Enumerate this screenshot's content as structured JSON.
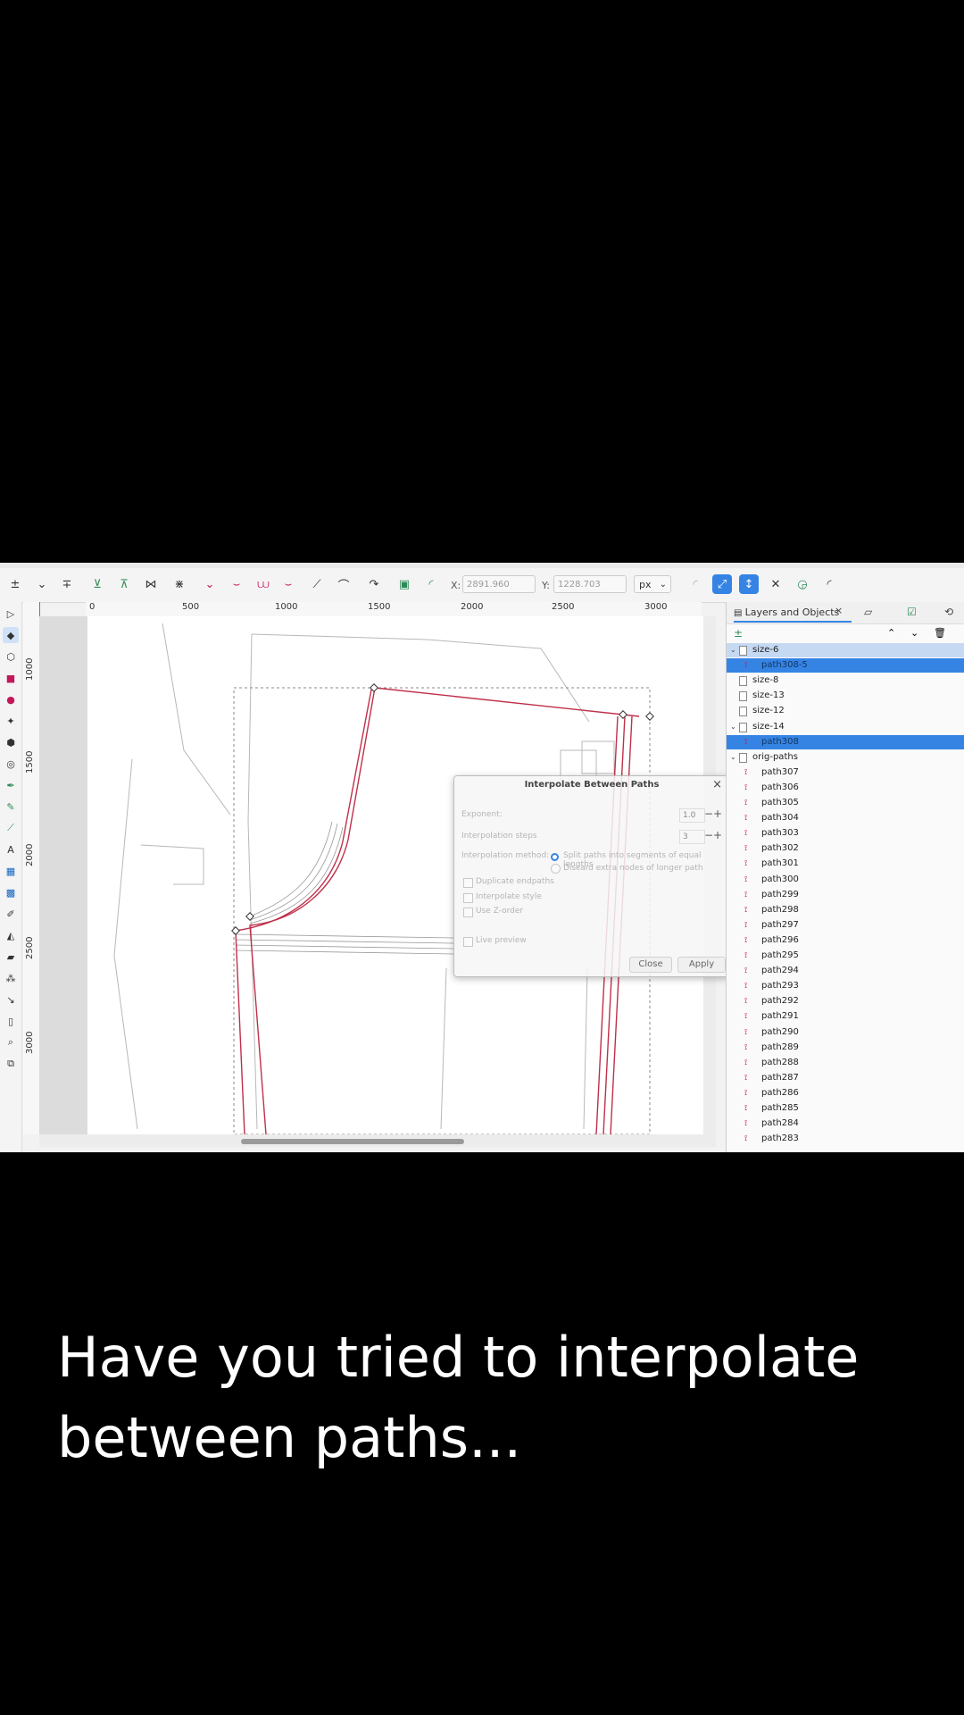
{
  "toolbar": {
    "x_label": "X:",
    "x_value": "2891.960",
    "y_label": "Y:",
    "y_value": "1228.703",
    "unit": "px"
  },
  "ruler": {
    "h_ticks": [
      "0",
      "500",
      "1000",
      "1500",
      "2000",
      "2500",
      "3000"
    ],
    "v_ticks": [
      "1000",
      "1500",
      "2000",
      "2500",
      "3000"
    ]
  },
  "dialog": {
    "title": "Interpolate Between Paths",
    "close_glyph": "×",
    "exponent_label": "Exponent:",
    "exponent_value": "1.0",
    "steps_label": "Interpolation steps",
    "steps_value": "3",
    "method_label": "Interpolation method:",
    "method_option_1": "Split paths into segments of equal lengths",
    "method_option_2": "Discard extra nodes of longer path",
    "duplicate_endpaths": "Duplicate endpaths",
    "interpolate_style": "Interpolate style",
    "use_z_order": "Use Z-order",
    "live_preview": "Live preview",
    "close_button": "Close",
    "apply_button": "Apply"
  },
  "panel": {
    "tab_title": "Layers and Objects",
    "tab_close": "×",
    "objects": [
      {
        "label": "size-6",
        "kind": "layer",
        "expanded": true,
        "state": "group-sel"
      },
      {
        "label": "path308-5",
        "kind": "path",
        "state": "selected"
      },
      {
        "label": "size-8",
        "kind": "layer"
      },
      {
        "label": "size-13",
        "kind": "layer"
      },
      {
        "label": "size-12",
        "kind": "layer"
      },
      {
        "label": "size-14",
        "kind": "layer",
        "expanded": true
      },
      {
        "label": "path308",
        "kind": "path",
        "state": "selected"
      },
      {
        "label": "orig-paths",
        "kind": "layer",
        "expanded": true
      },
      {
        "label": "path307",
        "kind": "path"
      },
      {
        "label": "path306",
        "kind": "path"
      },
      {
        "label": "path305",
        "kind": "path"
      },
      {
        "label": "path304",
        "kind": "path"
      },
      {
        "label": "path303",
        "kind": "path"
      },
      {
        "label": "path302",
        "kind": "path"
      },
      {
        "label": "path301",
        "kind": "path"
      },
      {
        "label": "path300",
        "kind": "path"
      },
      {
        "label": "path299",
        "kind": "path"
      },
      {
        "label": "path298",
        "kind": "path"
      },
      {
        "label": "path297",
        "kind": "path"
      },
      {
        "label": "path296",
        "kind": "path"
      },
      {
        "label": "path295",
        "kind": "path"
      },
      {
        "label": "path294",
        "kind": "path"
      },
      {
        "label": "path293",
        "kind": "path"
      },
      {
        "label": "path292",
        "kind": "path"
      },
      {
        "label": "path291",
        "kind": "path"
      },
      {
        "label": "path290",
        "kind": "path"
      },
      {
        "label": "path289",
        "kind": "path"
      },
      {
        "label": "path288",
        "kind": "path"
      },
      {
        "label": "path287",
        "kind": "path"
      },
      {
        "label": "path286",
        "kind": "path"
      },
      {
        "label": "path285",
        "kind": "path"
      },
      {
        "label": "path284",
        "kind": "path"
      },
      {
        "label": "path283",
        "kind": "path"
      }
    ]
  },
  "caption": {
    "line1": "Have you tried to interpolate",
    "line2": "between paths..."
  },
  "colors": {
    "accent": "#3584e4",
    "path_red": "#c0304a"
  }
}
